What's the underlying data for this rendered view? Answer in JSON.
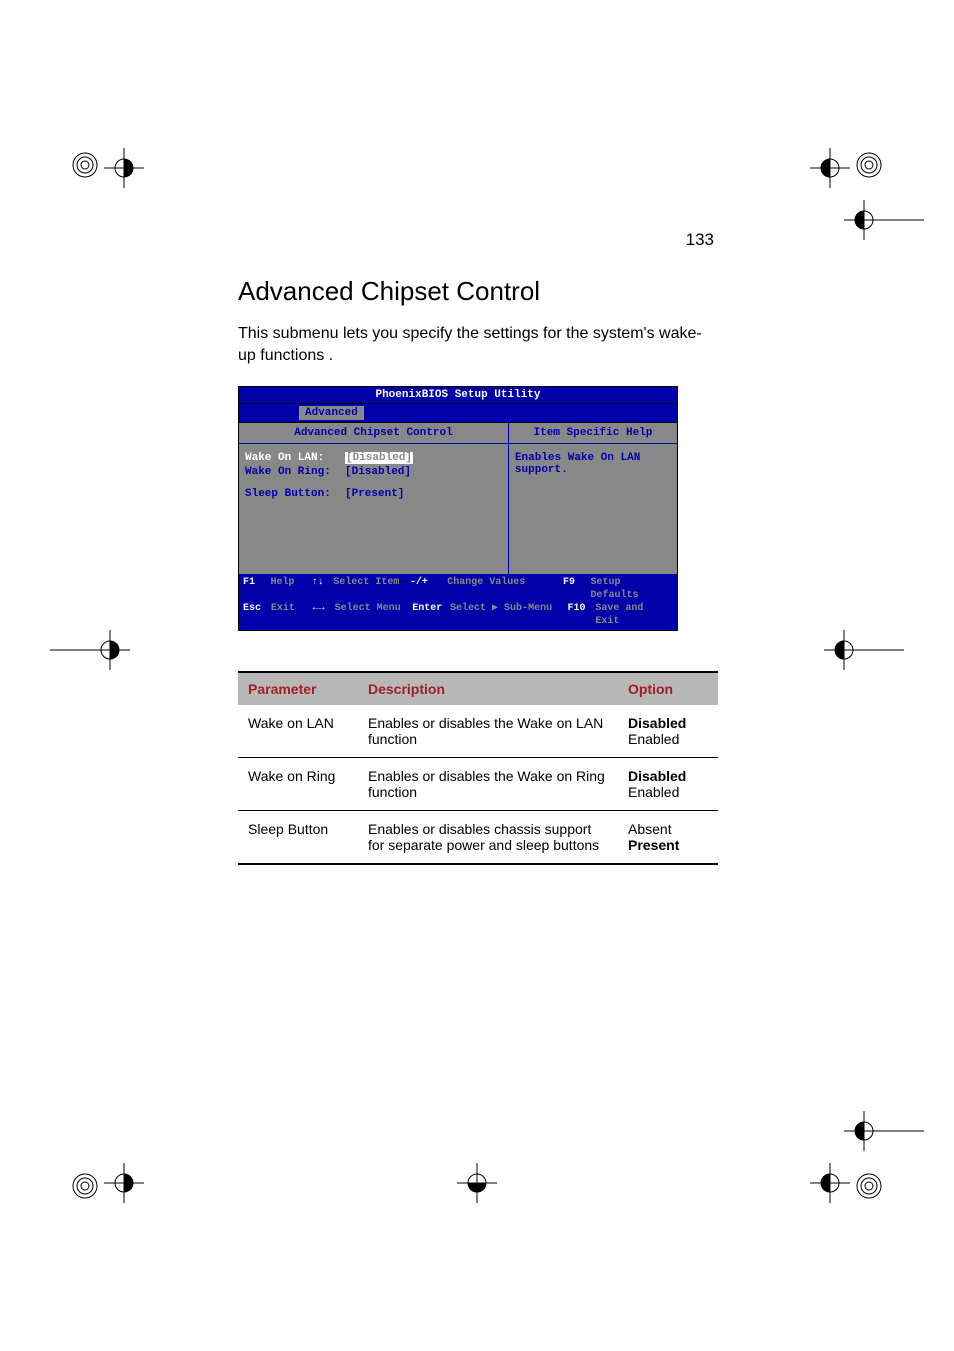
{
  "page_number": "133",
  "title": "Advanced Chipset Control",
  "intro": "This submenu lets you specify the settings for the system's wake-up functions .",
  "bios": {
    "titlebar": "PhoenixBIOS Setup Utility",
    "active_tab": "Advanced",
    "left_panel_title": "Advanced Chipset Control",
    "right_panel_title": "Item Specific Help",
    "help_text": "Enables Wake On LAN support.",
    "rows": {
      "r1_label": "Wake On LAN:",
      "r1_value": "[Disabled]",
      "r2_label": "Wake On Ring:",
      "r2_value": "[Disabled]",
      "r3_label": "Sleep Button:",
      "r3_value": "[Present]"
    },
    "footer": {
      "f1_key": "F1",
      "f1_lbl": "Help",
      "f2_key": "↑↓",
      "f2_lbl": "Select Item",
      "f3_key": "-/+",
      "f3_lbl": "Change Values",
      "f4_key": "F9",
      "f4_lbl": "Setup Defaults",
      "f5_key": "Esc",
      "f5_lbl": "Exit",
      "f6_key": "←→",
      "f6_lbl": "Select Menu",
      "f7_key": "Enter",
      "f7_lbl": "Select ▶ Sub-Menu",
      "f8_key": "F10",
      "f8_lbl": "Save and Exit"
    }
  },
  "table": {
    "headers": {
      "parameter": "Parameter",
      "description": "Description",
      "option": "Option"
    },
    "row1": {
      "param": "Wake on LAN",
      "desc": "Enables or disables the Wake on LAN function",
      "opt1": "Disabled",
      "opt2": "Enabled"
    },
    "row2": {
      "param": "Wake on Ring",
      "desc": "Enables or disables the Wake on Ring function",
      "opt1": "Disabled",
      "opt2": "Enabled"
    },
    "row3": {
      "param": "Sleep Button",
      "desc": "Enables or disables chassis support for separate power and sleep buttons",
      "opt1": "Absent",
      "opt2": "Present"
    }
  }
}
